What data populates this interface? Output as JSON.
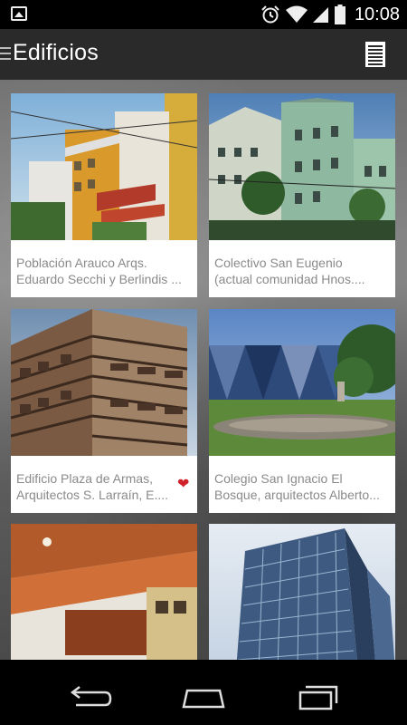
{
  "status_bar": {
    "time": "10:08",
    "icons": [
      "gallery-icon",
      "alarm-icon",
      "wifi-icon",
      "signal-icon",
      "battery-icon"
    ]
  },
  "action_bar": {
    "title": "Edificios",
    "icons": [
      "drawer-menu-icon",
      "list-view-icon"
    ]
  },
  "cards": [
    {
      "line1": "Población Arauco Arqs.",
      "line2": "Eduardo Secchi y Berlindis ...",
      "favorite": false
    },
    {
      "line1": "Colectivo San Eugenio",
      "line2": "(actual comunidad Hnos....",
      "favorite": false
    },
    {
      "line1": "Edificio Plaza de Armas,",
      "line2": "Arquitectos S. Larraín, E....",
      "favorite": true
    },
    {
      "line1": "Colegio San Ignacio El",
      "line2": "Bosque, arquitectos Alberto...",
      "favorite": false
    },
    {
      "line1": "",
      "line2": "",
      "favorite": false
    },
    {
      "line1": "",
      "line2": "",
      "favorite": false
    }
  ],
  "colors": {
    "action_bar": "#2a2a2a",
    "heart": "#d0222a",
    "caption_text": "#8a8a8a"
  },
  "nav_bar": {
    "icons": [
      "back-icon",
      "home-icon",
      "recent-apps-icon"
    ]
  }
}
